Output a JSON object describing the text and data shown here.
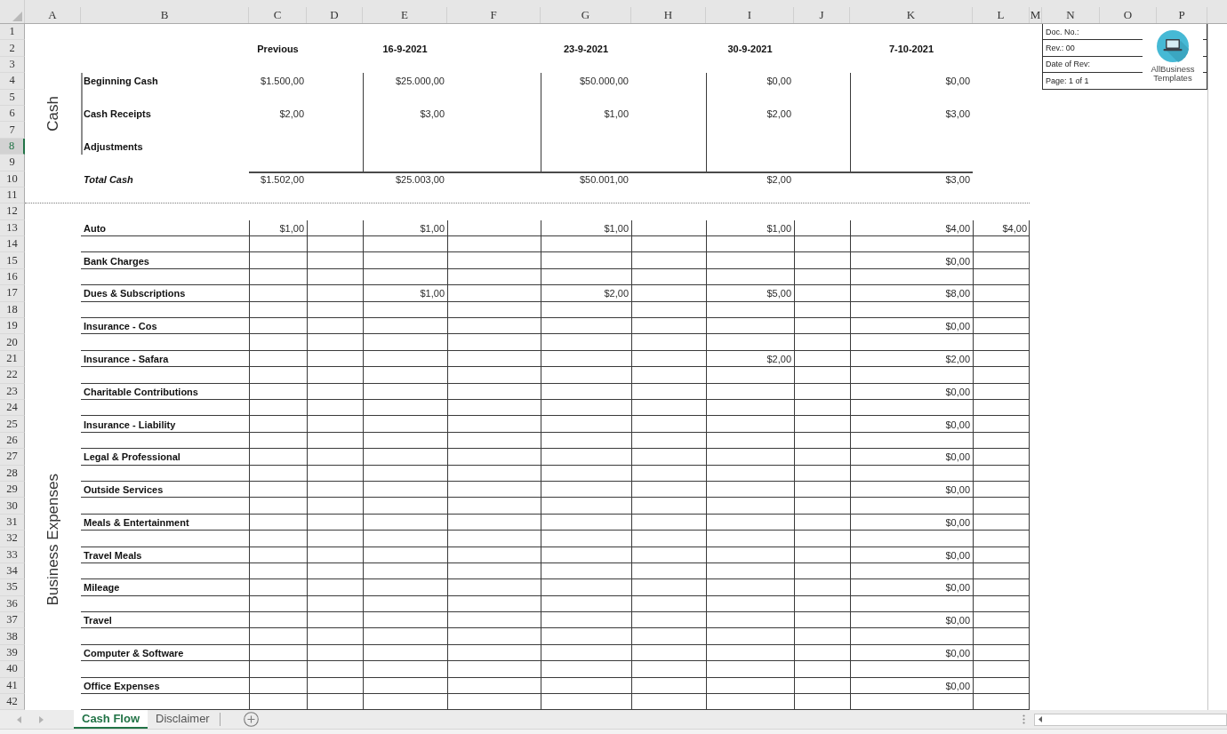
{
  "column_headers": [
    "A",
    "B",
    "C",
    "D",
    "E",
    "F",
    "G",
    "H",
    "I",
    "J",
    "K",
    "L",
    "M",
    "N",
    "O",
    "P"
  ],
  "row_headers": [
    {
      "label": "1",
      "selected": false
    },
    {
      "label": "2",
      "selected": false
    },
    {
      "label": "3",
      "selected": false
    },
    {
      "label": "4",
      "selected": false
    },
    {
      "label": "5",
      "selected": false
    },
    {
      "label": "6",
      "selected": false
    },
    {
      "label": "7",
      "selected": false
    },
    {
      "label": "8",
      "selected": true
    },
    {
      "label": "9",
      "selected": false
    },
    {
      "label": "10",
      "selected": false
    },
    {
      "label": "11",
      "selected": false
    },
    {
      "label": "12",
      "selected": false
    },
    {
      "label": "13",
      "selected": false
    },
    {
      "label": "14",
      "selected": false
    },
    {
      "label": "15",
      "selected": false
    },
    {
      "label": "16",
      "selected": false
    },
    {
      "label": "17",
      "selected": false
    },
    {
      "label": "18",
      "selected": false
    },
    {
      "label": "19",
      "selected": false
    },
    {
      "label": "20",
      "selected": false
    },
    {
      "label": "21",
      "selected": false
    },
    {
      "label": "22",
      "selected": false
    },
    {
      "label": "23",
      "selected": false
    },
    {
      "label": "24",
      "selected": false
    },
    {
      "label": "25",
      "selected": false
    },
    {
      "label": "26",
      "selected": false
    },
    {
      "label": "27",
      "selected": false
    },
    {
      "label": "28",
      "selected": false
    },
    {
      "label": "29",
      "selected": false
    },
    {
      "label": "30",
      "selected": false
    },
    {
      "label": "31",
      "selected": false
    },
    {
      "label": "32",
      "selected": false
    },
    {
      "label": "33",
      "selected": false
    },
    {
      "label": "34",
      "selected": false
    },
    {
      "label": "35",
      "selected": false
    },
    {
      "label": "36",
      "selected": false
    },
    {
      "label": "37",
      "selected": false
    },
    {
      "label": "38",
      "selected": false
    },
    {
      "label": "39",
      "selected": false
    },
    {
      "label": "40",
      "selected": false
    },
    {
      "label": "41",
      "selected": false
    },
    {
      "label": "42",
      "selected": false
    }
  ],
  "doc_info": {
    "fields": [
      "Doc. No.:",
      "Rev.: 00",
      "Date of Rev:",
      "Page: 1 of 1"
    ],
    "logo_text": "AllBusiness Templates"
  },
  "cash": {
    "label": "Cash",
    "periods": [
      "Previous",
      "16-9-2021",
      "23-9-2021",
      "30-9-2021",
      "7-10-2021"
    ],
    "rows": [
      {
        "label": "Beginning Cash",
        "kind": "item",
        "values": [
          "$1.500,00",
          "$25.000,00",
          "$50.000,00",
          "$0,00",
          "$0,00"
        ]
      },
      {
        "label": "Cash Receipts",
        "kind": "item",
        "values": [
          "$2,00",
          "$3,00",
          "$1,00",
          "$2,00",
          "$3,00"
        ]
      },
      {
        "label": "Adjustments",
        "kind": "item"
      },
      {
        "label": "Total Cash",
        "kind": "total",
        "values": [
          "$1.502,00",
          "$25.003,00",
          "$50.001,00",
          "$2,00",
          "$3,00"
        ]
      }
    ]
  },
  "expenses": {
    "label": "Business Expenses",
    "rows": [
      {
        "label": "Auto",
        "amounts": {
          "C": "$1,00",
          "E": "$1,00",
          "G": "$1,00",
          "I": "$1,00",
          "K": "$4,00",
          "L": "$4,00"
        }
      },
      {
        "label": "Bank Charges",
        "amounts": {
          "K": "$0,00"
        }
      },
      {
        "label": "Dues & Subscriptions",
        "amounts": {
          "E": "$1,00",
          "G": "$2,00",
          "I": "$5,00",
          "K": "$8,00"
        }
      },
      {
        "label": "Insurance - Cos",
        "amounts": {
          "K": "$0,00"
        }
      },
      {
        "label": "Insurance - Safara",
        "amounts": {
          "I": "$2,00",
          "K": "$2,00"
        }
      },
      {
        "label": "Charitable Contributions",
        "amounts": {
          "K": "$0,00"
        }
      },
      {
        "label": "Insurance - Liability",
        "amounts": {
          "K": "$0,00"
        }
      },
      {
        "label": "Legal & Professional",
        "amounts": {
          "K": "$0,00"
        }
      },
      {
        "label": "Outside Services",
        "amounts": {
          "K": "$0,00"
        }
      },
      {
        "label": "Meals & Entertainment",
        "amounts": {
          "K": "$0,00"
        }
      },
      {
        "label": "Travel Meals",
        "amounts": {
          "K": "$0,00"
        }
      },
      {
        "label": "Mileage",
        "amounts": {
          "K": "$0,00"
        }
      },
      {
        "label": "Travel",
        "amounts": {
          "K": "$0,00"
        }
      },
      {
        "label": "Computer & Software",
        "amounts": {
          "K": "$0,00"
        }
      },
      {
        "label": "Office Expenses",
        "amounts": {
          "K": "$0,00"
        }
      }
    ]
  },
  "sheet_tabs": [
    {
      "label": "Cash Flow",
      "selected": true
    },
    {
      "label": "Disclaimer",
      "selected": false
    }
  ]
}
